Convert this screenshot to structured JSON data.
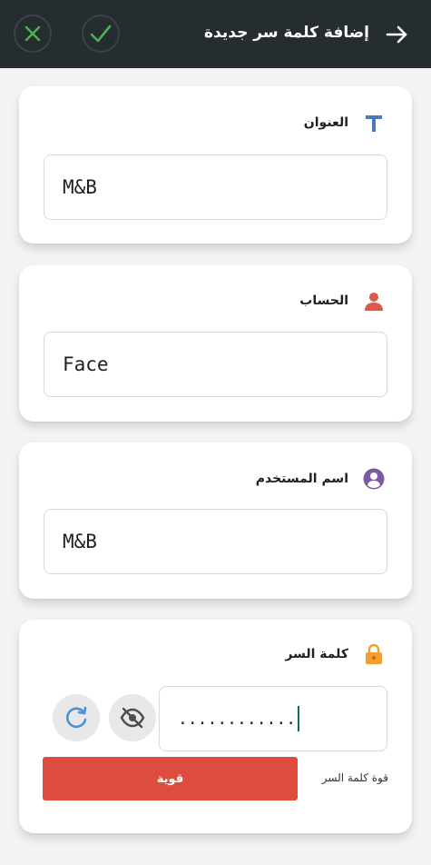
{
  "header": {
    "title": "إضافة كلمة سر جديدة"
  },
  "colors": {
    "header_bg": "#262d31",
    "confirm_green": "#4caf50",
    "cancel_green": "#4caf50",
    "strength_red": "#dd4c3f",
    "title_icon_blue": "#4a79b7",
    "account_icon_red": "#e0574c",
    "user_icon_purple": "#7b5aa6",
    "lock_icon_orange": "#f0a030"
  },
  "form": {
    "title": {
      "label": "العنوان",
      "value": "M&B",
      "icon": "text-t-icon"
    },
    "account": {
      "label": "الحساب",
      "value": "Face",
      "icon": "person-icon"
    },
    "username": {
      "label": "اسم المستخدم",
      "value": "M&B",
      "icon": "user-circle-icon"
    },
    "password": {
      "label": "كلمة السر",
      "value": "............",
      "icon": "lock-icon",
      "strength_label": "قوة كلمة السر",
      "strength_value": "قوية"
    }
  }
}
